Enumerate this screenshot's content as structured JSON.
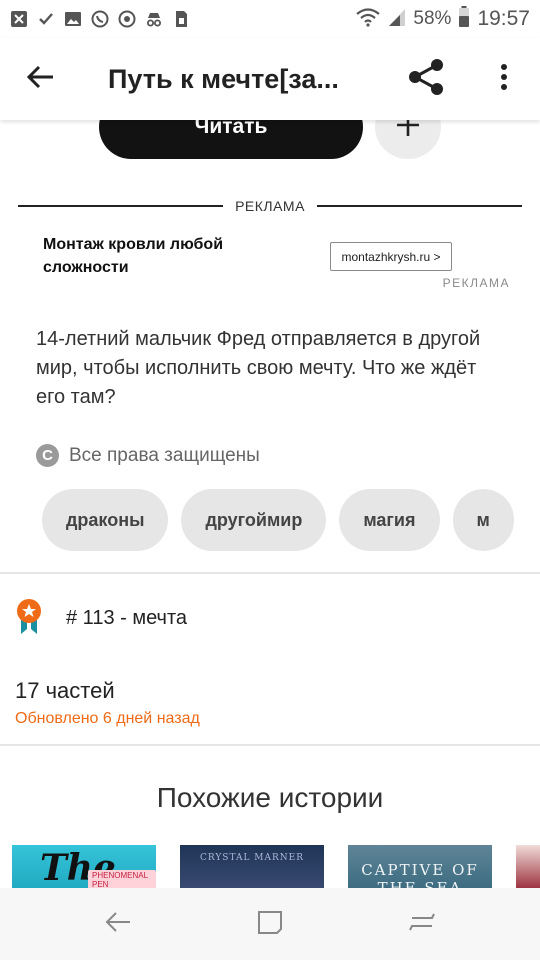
{
  "status_bar": {
    "battery_percent": "58%",
    "time": "19:57",
    "icons": [
      "missed-call-icon",
      "check-icon",
      "gallery-icon",
      "whatsapp-icon",
      "camera-icon",
      "incognito-icon",
      "sim-icon",
      "wifi-icon",
      "signal-icon",
      "battery-icon"
    ]
  },
  "toolbar": {
    "title": "Путь к мечте[за...",
    "back_icon": "arrow-back-icon",
    "share_icon": "share-icon",
    "more_icon": "more-vertical-icon"
  },
  "actions": {
    "read_label": "Читать",
    "add_icon": "plus-icon"
  },
  "ad": {
    "header_label": "РЕКЛАМА",
    "text": "Монтаж кровли любой сложности",
    "link_label": "montazhkrysh.ru >",
    "sub_label": "РЕКЛАМА"
  },
  "story": {
    "description": "14-летний мальчик Фред отправляется в другой мир, чтобы исполнить свою мечту. Что же ждёт его там?",
    "copyright_icon": "copyright-icon",
    "copyright": "Все права защищены",
    "tags": [
      "драконы",
      "другоймир",
      "магия",
      "м"
    ],
    "rank_icon": "ranking-badge-icon",
    "rank": "# 113 - мечта",
    "parts": "17 частей",
    "updated": "Обновлено 6 дней назад"
  },
  "similar": {
    "title": "Похожие истории",
    "covers": [
      {
        "big": "The",
        "badge": "PHENOMENAL PEN"
      },
      {
        "author": "CRYSTAL MARNER"
      },
      {
        "line1": "CAPTIVE OF",
        "line2": "THE SEA"
      },
      {}
    ]
  },
  "nav": {
    "back_icon": "nav-back-icon",
    "home_icon": "nav-home-icon",
    "recents_icon": "nav-recents-icon"
  },
  "colors": {
    "accent": "#ef6b17",
    "read_button": "#121212",
    "tag_bg": "#e6e6e6"
  }
}
